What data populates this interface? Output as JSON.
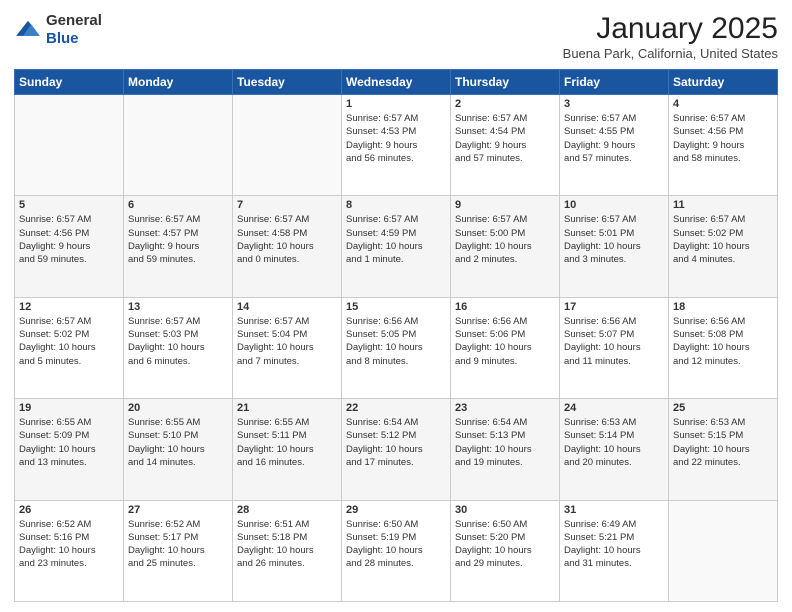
{
  "header": {
    "logo_general": "General",
    "logo_blue": "Blue",
    "title": "January 2025",
    "location": "Buena Park, California, United States"
  },
  "days_of_week": [
    "Sunday",
    "Monday",
    "Tuesday",
    "Wednesday",
    "Thursday",
    "Friday",
    "Saturday"
  ],
  "weeks": [
    {
      "row_style": "row-normal",
      "cells": [
        {
          "date": "",
          "info": "",
          "empty": true
        },
        {
          "date": "",
          "info": "",
          "empty": true
        },
        {
          "date": "",
          "info": "",
          "empty": true
        },
        {
          "date": "1",
          "info": "Sunrise: 6:57 AM\nSunset: 4:53 PM\nDaylight: 9 hours\nand 56 minutes."
        },
        {
          "date": "2",
          "info": "Sunrise: 6:57 AM\nSunset: 4:54 PM\nDaylight: 9 hours\nand 57 minutes."
        },
        {
          "date": "3",
          "info": "Sunrise: 6:57 AM\nSunset: 4:55 PM\nDaylight: 9 hours\nand 57 minutes."
        },
        {
          "date": "4",
          "info": "Sunrise: 6:57 AM\nSunset: 4:56 PM\nDaylight: 9 hours\nand 58 minutes."
        }
      ]
    },
    {
      "row_style": "row-alt",
      "cells": [
        {
          "date": "5",
          "info": "Sunrise: 6:57 AM\nSunset: 4:56 PM\nDaylight: 9 hours\nand 59 minutes."
        },
        {
          "date": "6",
          "info": "Sunrise: 6:57 AM\nSunset: 4:57 PM\nDaylight: 9 hours\nand 59 minutes."
        },
        {
          "date": "7",
          "info": "Sunrise: 6:57 AM\nSunset: 4:58 PM\nDaylight: 10 hours\nand 0 minutes."
        },
        {
          "date": "8",
          "info": "Sunrise: 6:57 AM\nSunset: 4:59 PM\nDaylight: 10 hours\nand 1 minute."
        },
        {
          "date": "9",
          "info": "Sunrise: 6:57 AM\nSunset: 5:00 PM\nDaylight: 10 hours\nand 2 minutes."
        },
        {
          "date": "10",
          "info": "Sunrise: 6:57 AM\nSunset: 5:01 PM\nDaylight: 10 hours\nand 3 minutes."
        },
        {
          "date": "11",
          "info": "Sunrise: 6:57 AM\nSunset: 5:02 PM\nDaylight: 10 hours\nand 4 minutes."
        }
      ]
    },
    {
      "row_style": "row-normal",
      "cells": [
        {
          "date": "12",
          "info": "Sunrise: 6:57 AM\nSunset: 5:02 PM\nDaylight: 10 hours\nand 5 minutes."
        },
        {
          "date": "13",
          "info": "Sunrise: 6:57 AM\nSunset: 5:03 PM\nDaylight: 10 hours\nand 6 minutes."
        },
        {
          "date": "14",
          "info": "Sunrise: 6:57 AM\nSunset: 5:04 PM\nDaylight: 10 hours\nand 7 minutes."
        },
        {
          "date": "15",
          "info": "Sunrise: 6:56 AM\nSunset: 5:05 PM\nDaylight: 10 hours\nand 8 minutes."
        },
        {
          "date": "16",
          "info": "Sunrise: 6:56 AM\nSunset: 5:06 PM\nDaylight: 10 hours\nand 9 minutes."
        },
        {
          "date": "17",
          "info": "Sunrise: 6:56 AM\nSunset: 5:07 PM\nDaylight: 10 hours\nand 11 minutes."
        },
        {
          "date": "18",
          "info": "Sunrise: 6:56 AM\nSunset: 5:08 PM\nDaylight: 10 hours\nand 12 minutes."
        }
      ]
    },
    {
      "row_style": "row-alt",
      "cells": [
        {
          "date": "19",
          "info": "Sunrise: 6:55 AM\nSunset: 5:09 PM\nDaylight: 10 hours\nand 13 minutes."
        },
        {
          "date": "20",
          "info": "Sunrise: 6:55 AM\nSunset: 5:10 PM\nDaylight: 10 hours\nand 14 minutes."
        },
        {
          "date": "21",
          "info": "Sunrise: 6:55 AM\nSunset: 5:11 PM\nDaylight: 10 hours\nand 16 minutes."
        },
        {
          "date": "22",
          "info": "Sunrise: 6:54 AM\nSunset: 5:12 PM\nDaylight: 10 hours\nand 17 minutes."
        },
        {
          "date": "23",
          "info": "Sunrise: 6:54 AM\nSunset: 5:13 PM\nDaylight: 10 hours\nand 19 minutes."
        },
        {
          "date": "24",
          "info": "Sunrise: 6:53 AM\nSunset: 5:14 PM\nDaylight: 10 hours\nand 20 minutes."
        },
        {
          "date": "25",
          "info": "Sunrise: 6:53 AM\nSunset: 5:15 PM\nDaylight: 10 hours\nand 22 minutes."
        }
      ]
    },
    {
      "row_style": "row-normal",
      "cells": [
        {
          "date": "26",
          "info": "Sunrise: 6:52 AM\nSunset: 5:16 PM\nDaylight: 10 hours\nand 23 minutes."
        },
        {
          "date": "27",
          "info": "Sunrise: 6:52 AM\nSunset: 5:17 PM\nDaylight: 10 hours\nand 25 minutes."
        },
        {
          "date": "28",
          "info": "Sunrise: 6:51 AM\nSunset: 5:18 PM\nDaylight: 10 hours\nand 26 minutes."
        },
        {
          "date": "29",
          "info": "Sunrise: 6:50 AM\nSunset: 5:19 PM\nDaylight: 10 hours\nand 28 minutes."
        },
        {
          "date": "30",
          "info": "Sunrise: 6:50 AM\nSunset: 5:20 PM\nDaylight: 10 hours\nand 29 minutes."
        },
        {
          "date": "31",
          "info": "Sunrise: 6:49 AM\nSunset: 5:21 PM\nDaylight: 10 hours\nand 31 minutes."
        },
        {
          "date": "",
          "info": "",
          "empty": true
        }
      ]
    }
  ]
}
